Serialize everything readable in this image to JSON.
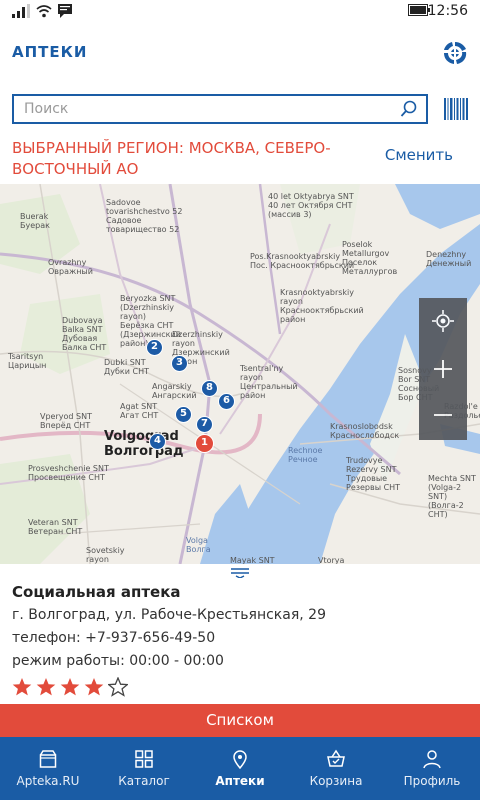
{
  "status_bar": {
    "time": "12:56"
  },
  "header": {
    "title": "АПТЕКИ",
    "logo_icon": "pharmacy-logo-icon"
  },
  "search": {
    "placeholder": "Поиск",
    "value": "",
    "search_icon": "search-icon",
    "barcode_icon": "barcode-icon"
  },
  "region": {
    "label": "Выбранный регион: Москва, Северо-Восточный АО",
    "change_label": "Сменить"
  },
  "map": {
    "labels": {
      "tr_bot": "40 let Oktyabrya SNT\n40 лет Октября СНТ\n(массив 3)",
      "sadovoe": "Sadovoe\ntovarishchestvo 52\nСадовое\nтоварищество 52",
      "beryozka": "Beryozka SNT\nБерезка СНТ",
      "dzerzh_top": "Beryozka SNT\n(Dzerzhinskiy\nrayon)\nБерёзка СНТ\n(Дзержинский\nрайон)",
      "buerak": "Buerak\nБуерак",
      "ovrazhny": "Ovrazhny\nОвражный",
      "pos_krasnookt": "Pos.Krasnooktyabrskiy\nПос. Краснооктябрьский",
      "poselok": "Poselok\nMetallurgov\nПоселок\nМеталлургов",
      "krasnookt_rayon": "Krasnooktyabrskiy\nrayon\nКраснооктябрьский\nрайон",
      "dubovaya": "Dubovaya\nBalka SNT\nДубовая\nБалка СНТ",
      "dubki": "Dubki SNT\nДубки СНТ",
      "dzerzh": "Dzerzhinskiy\nrayon\nДзержинский\nрайон",
      "tsaritsyn": "Tsaritsyn\nЦарицын",
      "angarskiy": "Angarskiy\nАнгарский",
      "agat": "Agat SNT\nАгат СНТ",
      "tsentralny": "Tsentral'ny\nrayon\nЦентральный\nрайон",
      "vperyod": "Vperyod SNT\nВперёд СНТ",
      "volgograd": "Volgograd\nВолгоград",
      "krasnoslobodsk": "Krasnoslobodsk\nКраснослободск",
      "sosnovy": "Sosnovy\nBor SNT\nСосновый\nБор СНТ",
      "razdole": "Razdol'e\nРаздолье",
      "trudovye": "Trudovye\nRezervy SNT\nТрудовые\nРезервы СНТ",
      "prosveshchenie": "Prosveshchenie SNT\nПросвещение СНТ",
      "veteran": "Veteran SNT\nВетеран СНТ",
      "sovetskiy": "Sovetskiy\nrayon",
      "mechta": "Mechta SNT\n(Volga-2\nSNT)\n(Волга-2\nСНТ)",
      "mayak": "Mayak SNT",
      "vtorya": "Vtorya",
      "denezhny": "Denezhny\nДенежный",
      "rechnoe": "Rechnoe\nРечное",
      "volga": "Volga\nВолга"
    },
    "markers": [
      "1",
      "2",
      "3",
      "4",
      "5",
      "6",
      "7",
      "8"
    ],
    "controls": [
      "locate-icon",
      "zoom-in-icon",
      "zoom-out-icon"
    ]
  },
  "pharmacy": {
    "name": "Социальная аптека",
    "address": "г. Волгоград, ул. Рабоче-Крестьянская, 29",
    "phone": "телефон: +7-937-656-49-50",
    "hours": "режим работы: 00:00 - 00:00",
    "rating": 4,
    "rating_max": 5
  },
  "list_button": {
    "label": "Списком"
  },
  "nav": {
    "items": [
      {
        "label": "Apteka.RU",
        "icon": "box-icon"
      },
      {
        "label": "Каталог",
        "icon": "grid-icon"
      },
      {
        "label": "Аптеки",
        "icon": "location-pin-icon"
      },
      {
        "label": "Корзина",
        "icon": "basket-icon"
      },
      {
        "label": "Профиль",
        "icon": "person-icon"
      }
    ],
    "active_index": 2
  },
  "colors": {
    "brand": "#1a5ca5",
    "accent": "#e24b3b",
    "water": "#a7c7ec"
  }
}
